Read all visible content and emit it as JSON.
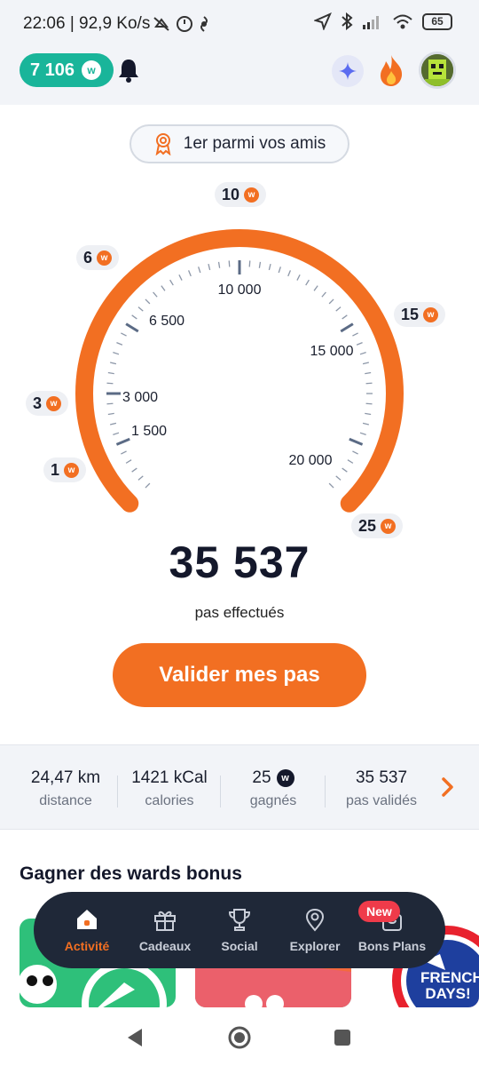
{
  "status_bar": {
    "text": "22:06 | 92,9 Ko/s",
    "battery": "65"
  },
  "header": {
    "wards_balance": "7 106",
    "coin_symbol": "w"
  },
  "rank": {
    "label": "1er parmi vos amis"
  },
  "gauge": {
    "scale_labels": [
      "1 500",
      "3 000",
      "6 500",
      "10 000",
      "15 000",
      "20 000"
    ],
    "rewards": [
      "1",
      "3",
      "6",
      "10",
      "15",
      "25"
    ],
    "steps_total": "35 537",
    "steps_caption": "pas effectués",
    "progress_fraction": 1.0,
    "accent_color": "#f26f22"
  },
  "validate_button": {
    "label": "Valider mes pas"
  },
  "stats": [
    {
      "value": "24,47 km",
      "label": "distance"
    },
    {
      "value": "1421 kCal",
      "label": "calories"
    },
    {
      "value": "25",
      "label": "gagnés"
    },
    {
      "value": "35 537",
      "label": "pas validés"
    }
  ],
  "bonus": {
    "title": "Gagner des wards bonus",
    "card_badge": "FRENCH DAYS!"
  },
  "nav": {
    "items": [
      {
        "label": "Activité",
        "icon": "home-icon"
      },
      {
        "label": "Cadeaux",
        "icon": "gift-icon"
      },
      {
        "label": "Social",
        "icon": "trophy-icon"
      },
      {
        "label": "Explorer",
        "icon": "location-pin-icon"
      },
      {
        "label": "Bons Plans",
        "icon": "shopping-bag-icon"
      }
    ],
    "new_badge": "New"
  }
}
